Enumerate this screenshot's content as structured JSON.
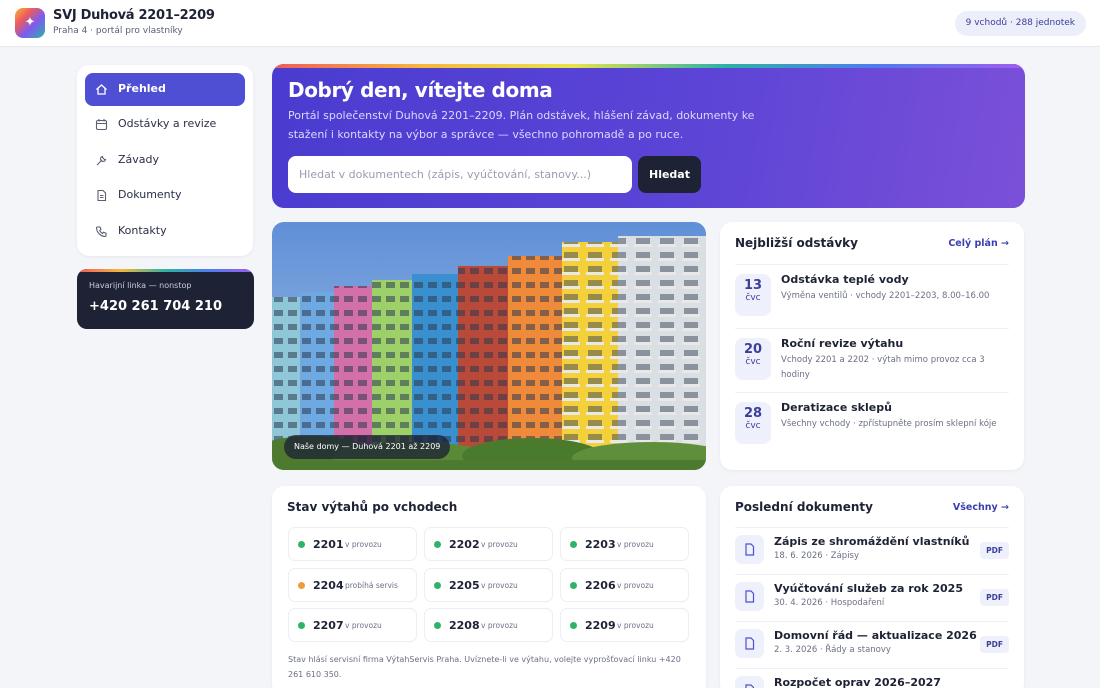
{
  "header": {
    "title": "SVJ Duhová 2201–2209",
    "subtitle": "Praha 4 · portál pro vlastníky",
    "badge": "9 vchodů · 288 jednotek"
  },
  "sidebar": {
    "items": [
      {
        "label": "Přehled",
        "icon": "home-icon",
        "active": true
      },
      {
        "label": "Odstávky a revize",
        "icon": "calendar-icon",
        "active": false
      },
      {
        "label": "Závady",
        "icon": "wrench-icon",
        "active": false
      },
      {
        "label": "Dokumenty",
        "icon": "document-icon",
        "active": false
      },
      {
        "label": "Kontakty",
        "icon": "phone-icon",
        "active": false
      }
    ],
    "emergency": {
      "label": "Havarijní linka — nonstop",
      "phone": "+420 261 704 210"
    }
  },
  "hero": {
    "title": "Dobrý den, vítejte doma",
    "text": "Portál společenství Duhová 2201–2209. Plán odstávek, hlášení závad, dokumenty ke stažení i kontakty na výbor a správce — všechno pohromadě a po ruce.",
    "search_placeholder": "Hledat v dokumentech (zápis, vyúčtování, stanovy...)",
    "search_button": "Hledat"
  },
  "photo": {
    "caption": "Naše domy — Duhová 2201 až 2209"
  },
  "maintenance": {
    "title": "Nejbližší odstávky",
    "link": "Celý plán →",
    "items": [
      {
        "day": "13",
        "month": "čvc",
        "title": "Odstávka teplé vody",
        "desc": "Výměna ventilů · vchody 2201–2203, 8.00–16.00"
      },
      {
        "day": "20",
        "month": "čvc",
        "title": "Roční revize výtahu",
        "desc": "Vchody 2201 a 2202 · výtah mimo provoz cca 3 hodiny"
      },
      {
        "day": "28",
        "month": "čvc",
        "title": "Deratizace sklepů",
        "desc": "Všechny vchody · zpřístupněte prosím sklepní kóje"
      }
    ]
  },
  "lifts": {
    "title": "Stav výtahů po vchodech",
    "items": [
      {
        "number": "2201",
        "status": "v provozu",
        "color": "#2fb36a"
      },
      {
        "number": "2202",
        "status": "v provozu",
        "color": "#2fb36a"
      },
      {
        "number": "2203",
        "status": "v provozu",
        "color": "#2fb36a"
      },
      {
        "number": "2204",
        "status": "probíhá servis",
        "color": "#f39a3c"
      },
      {
        "number": "2205",
        "status": "v provozu",
        "color": "#2fb36a"
      },
      {
        "number": "2206",
        "status": "v provozu",
        "color": "#2fb36a"
      },
      {
        "number": "2207",
        "status": "v provozu",
        "color": "#2fb36a"
      },
      {
        "number": "2208",
        "status": "v provozu",
        "color": "#2fb36a"
      },
      {
        "number": "2209",
        "status": "v provozu",
        "color": "#2fb36a"
      }
    ],
    "note": "Stav hlásí servisní firma VýtahServis Praha. Uvíznete-li ve výtahu, volejte vyprošťovací linku +420 261 610 350."
  },
  "documents": {
    "title": "Poslední dokumenty",
    "link": "Všechny →",
    "items": [
      {
        "title": "Zápis ze shromáždění vlastníků",
        "meta": "18. 6. 2026 · Zápisy",
        "badge": "PDF"
      },
      {
        "title": "Vyúčtování služeb za rok 2025",
        "meta": "30. 4. 2026 · Hospodaření",
        "badge": "PDF"
      },
      {
        "title": "Domovní řád — aktualizace 2026",
        "meta": "2. 3. 2026 · Řády a stanovy",
        "badge": "PDF"
      },
      {
        "title": "Rozpočet oprav 2026–2027",
        "meta": "",
        "badge": ""
      }
    ]
  }
}
